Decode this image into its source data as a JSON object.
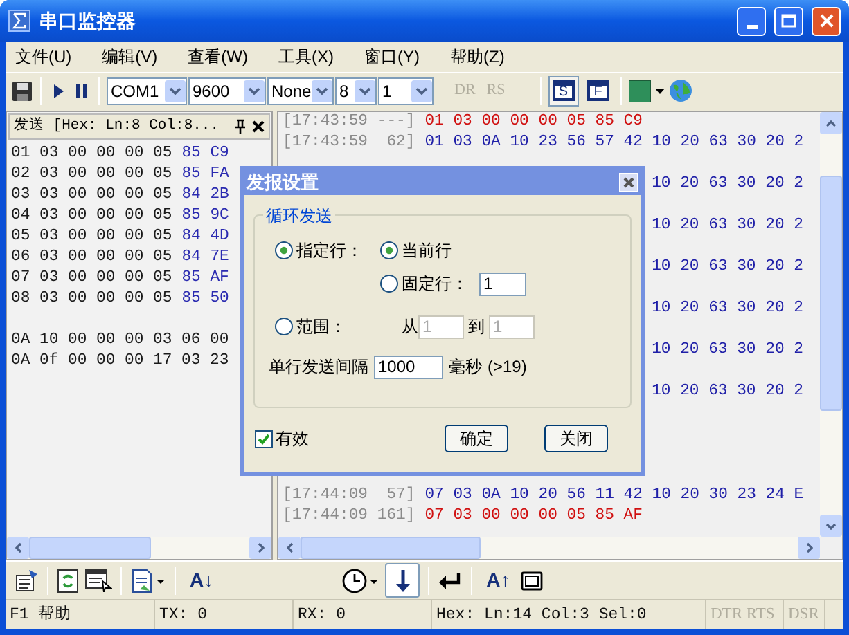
{
  "window": {
    "title": "串口监控器"
  },
  "menu": [
    {
      "label": "文件(U)"
    },
    {
      "label": "编辑(V)"
    },
    {
      "label": "查看(W)"
    },
    {
      "label": "工具(X)"
    },
    {
      "label": "窗口(Y)"
    },
    {
      "label": "帮助(Z)"
    }
  ],
  "toolbar": {
    "port": "COM1",
    "baud": "9600",
    "parity": "None",
    "data_bits": "8",
    "stop_bits": "1",
    "signals": [
      "DR",
      "RS"
    ],
    "view_buttons": [
      {
        "label": "S",
        "selected": true
      },
      {
        "label": "F",
        "selected": false
      }
    ]
  },
  "send_pane": {
    "title": "发送 [Hex: Ln:8 Col:8...",
    "lines": [
      {
        "kind": "data",
        "plain": "01 03 00 00 00 05",
        "crc": "85 C9"
      },
      {
        "kind": "data",
        "plain": "02 03 00 00 00 05",
        "crc": "85 FA"
      },
      {
        "kind": "data",
        "plain": "03 03 00 00 00 05",
        "crc": "84 2B"
      },
      {
        "kind": "data",
        "plain": "04 03 00 00 00 05",
        "crc": "85 9C"
      },
      {
        "kind": "data",
        "plain": "05 03 00 00 00 05",
        "crc": "84 4D"
      },
      {
        "kind": "data",
        "plain": "06 03 00 00 00 05",
        "crc": "84 7E"
      },
      {
        "kind": "data",
        "plain": "07 03 00 00 00 05",
        "crc": "85 AF"
      },
      {
        "kind": "data",
        "plain": "08 03 00 00 00 05",
        "crc": "85 50"
      },
      {
        "kind": "blank"
      },
      {
        "kind": "data",
        "plain": "0A 10 00 00 00 03 06 00"
      },
      {
        "kind": "data",
        "plain": "0A 0f 00 00 00 17 03 23"
      }
    ]
  },
  "log_pane": {
    "rows": [
      {
        "kind": "full",
        "time": "[17:43:59 ---]",
        "sent": true,
        "data": "01 03 00 00 00 05 85 C9"
      },
      {
        "kind": "full",
        "time": "[17:43:59  62]",
        "sent": false,
        "data": "01 03 0A 10 23 56 57 42 10 20 63 30 20 2"
      },
      {
        "kind": "hidden"
      },
      {
        "kind": "tail",
        "sent": false,
        "data": "10 20 63 30 20 2"
      },
      {
        "kind": "hidden"
      },
      {
        "kind": "tail",
        "sent": false,
        "data": "10 20 63 30 20 2"
      },
      {
        "kind": "hidden"
      },
      {
        "kind": "tail",
        "sent": false,
        "data": "10 20 63 30 20 2"
      },
      {
        "kind": "hidden"
      },
      {
        "kind": "tail",
        "sent": false,
        "data": "10 20 63 30 20 2"
      },
      {
        "kind": "hidden"
      },
      {
        "kind": "tail",
        "sent": false,
        "data": "10 20 63 30 20 2"
      },
      {
        "kind": "hidden"
      },
      {
        "kind": "tail",
        "sent": false,
        "data": "10 20 63 30 20 2"
      },
      {
        "kind": "hidden"
      },
      {
        "kind": "hidden"
      },
      {
        "kind": "hidden"
      },
      {
        "kind": "hidden"
      },
      {
        "kind": "full",
        "time": "[17:44:09  57]",
        "sent": false,
        "data": "07 03 0A 10 20 56 11 42 10 20 30 23 24 E"
      },
      {
        "kind": "full",
        "time": "[17:44:09 161]",
        "sent": true,
        "data": "07 03 00 00 00 05 85 AF"
      }
    ]
  },
  "dialog": {
    "title": "发报设置",
    "group": "循环发送",
    "specified": {
      "label": "指定行：",
      "selected": true
    },
    "current": {
      "label": "当前行",
      "selected": true
    },
    "fixed": {
      "label": "固定行：",
      "selected": false,
      "value": "1"
    },
    "range": {
      "label": "范围：",
      "selected": false,
      "from_label": "从",
      "from": "1",
      "to_label": "到",
      "to": "1"
    },
    "interval": {
      "label": "单行发送间隔",
      "value": "1000",
      "unit": "毫秒",
      "hint": "(>19)"
    },
    "enabled": {
      "label": "有效",
      "checked": true
    },
    "buttons": [
      "确定",
      "关闭"
    ]
  },
  "bottom_toolbar": [
    {
      "kind": "properties",
      "selected": false
    },
    {
      "kind": "separator"
    },
    {
      "kind": "refresh",
      "selected": false
    },
    {
      "kind": "list",
      "selected": false
    },
    {
      "kind": "separator"
    },
    {
      "kind": "document",
      "selected": false
    },
    {
      "kind": "separator"
    },
    {
      "kind": "text",
      "label": "A↓",
      "selected": false
    },
    {
      "kind": "gap"
    },
    {
      "kind": "clock",
      "selected": false
    },
    {
      "kind": "arrow-down",
      "selected": true
    },
    {
      "kind": "separator"
    },
    {
      "kind": "enter",
      "selected": false
    },
    {
      "kind": "separator"
    },
    {
      "kind": "text",
      "label": "A↑",
      "selected": false
    },
    {
      "kind": "frame",
      "selected": false
    }
  ],
  "status_bar": [
    {
      "text": "F1 帮助",
      "disabled": false
    },
    {
      "text": "TX: 0",
      "disabled": false
    },
    {
      "text": "RX: 0",
      "disabled": false
    },
    {
      "text": "Hex: Ln:14 Col:3 Sel:0",
      "disabled": false
    },
    {
      "text": "DTR RTS",
      "disabled": true
    },
    {
      "text": "DSR",
      "disabled": true
    }
  ]
}
